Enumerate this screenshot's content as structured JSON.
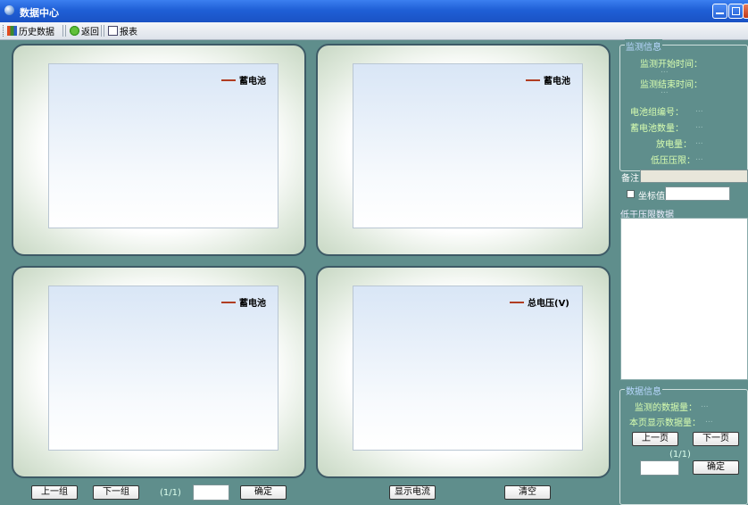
{
  "window": {
    "title": "数据中心"
  },
  "toolbar": {
    "history": "历史数据",
    "back": "返回",
    "report": "报表"
  },
  "charts": [
    {
      "legend": "蓄电池"
    },
    {
      "legend": "蓄电池"
    },
    {
      "legend": "蓄电池"
    },
    {
      "legend": "总电压(V)"
    }
  ],
  "bottom": {
    "prev_group": "上一组",
    "next_group": "下一组",
    "page": "(1/1)",
    "goto_value": "",
    "confirm": "确定",
    "show_current": "显示电流",
    "clear": "清空"
  },
  "monitor_info": {
    "legend": "监测信息",
    "start_label": "监测开始时间：",
    "start_value": "...",
    "end_label": "监测结束时间：",
    "end_value": "...",
    "group_no_label": "电池组编号：",
    "group_no_value": "...",
    "battery_count_label": "蓄电池数量：",
    "battery_count_value": "...",
    "discharge_label": "放电量：",
    "discharge_value": "...",
    "low_voltage_label": "低压压限：",
    "low_voltage_value": "...",
    "remark_label": "备注",
    "remark_value": "",
    "axis_label": "坐标值",
    "axis_value": "",
    "below_limit_label": "低于压限数据"
  },
  "data_info": {
    "legend": "数据信息",
    "monitored_count_label": "监测的数据量：",
    "monitored_count_value": "...",
    "page_count_label": "本页显示数据量：",
    "page_count_value": "...",
    "prev_page": "上一页",
    "next_page": "下一页",
    "page": "(1/1)",
    "goto_value": "",
    "confirm": "确定"
  }
}
